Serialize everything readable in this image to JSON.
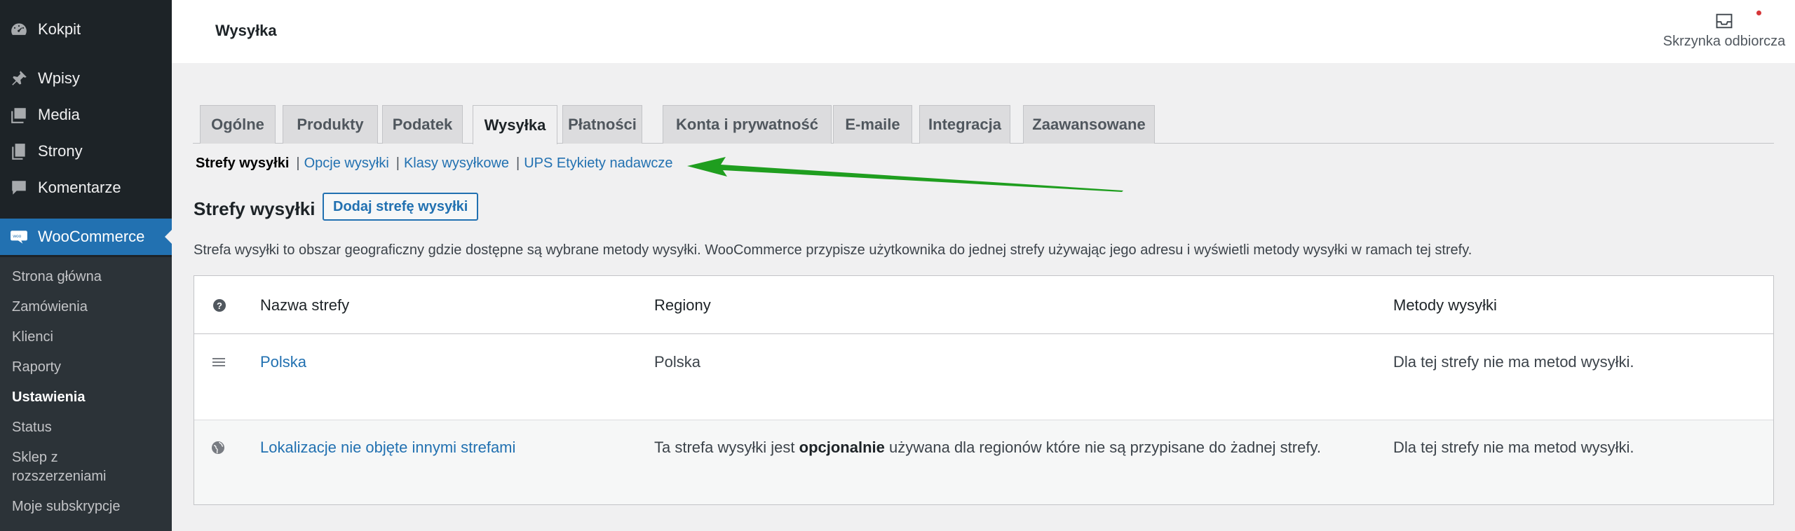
{
  "sidebar": {
    "items": [
      {
        "label": "Kokpit",
        "icon": "dashboard-icon"
      },
      {
        "label": "Wpisy",
        "icon": "pushpin-icon"
      },
      {
        "label": "Media",
        "icon": "media-icon"
      },
      {
        "label": "Strony",
        "icon": "pages-icon"
      },
      {
        "label": "Komentarze",
        "icon": "comment-icon"
      },
      {
        "label": "WooCommerce",
        "icon": "woo-icon"
      }
    ],
    "submenu": [
      {
        "label": "Strona główna"
      },
      {
        "label": "Zamówienia"
      },
      {
        "label": "Klienci"
      },
      {
        "label": "Raporty"
      },
      {
        "label": "Ustawienia"
      },
      {
        "label": "Status"
      },
      {
        "label": "Sklep z rozszerzeniami"
      },
      {
        "label": "Moje subskrypcje"
      }
    ]
  },
  "header": {
    "title": "Wysyłka",
    "inbox_label": "Skrzynka odbiorcza"
  },
  "tabs": [
    {
      "label": "Ogólne"
    },
    {
      "label": "Produkty"
    },
    {
      "label": "Podatek"
    },
    {
      "label": "Wysyłka",
      "active": true
    },
    {
      "label": "Płatności"
    },
    {
      "label": "Konta i prywatność"
    },
    {
      "label": "E-maile"
    },
    {
      "label": "Integracja"
    },
    {
      "label": "Zaawansowane"
    }
  ],
  "subnav": {
    "current": "Strefy wysyłki",
    "links": [
      "Opcje wysyłki",
      "Klasy wysyłkowe",
      "UPS Etykiety nadawcze"
    ],
    "separator": "|"
  },
  "annotation_arrow_color": "#1f9e1f",
  "zones": {
    "heading": "Strefy wysyłki",
    "add_button": "Dodaj strefę wysyłki",
    "description": "Strefa wysyłki to obszar geograficzny gdzie dostępne są wybrane metody wysyłki. WooCommerce przypisze użytkownika do jednej strefy używając jego adresu i wyświetli metody wysyłki w ramach tej strefy.",
    "columns": {
      "help_icon": "question-icon",
      "name": "Nazwa strefy",
      "regions": "Regiony",
      "methods": "Metody wysyłki"
    },
    "rows": [
      {
        "name": "Polska",
        "regions": "Polska",
        "methods": "Dla tej strefy nie ma metod wysyłki.",
        "icon": "drag-handle-icon"
      },
      {
        "name": "Lokalizacje nie objęte innymi strefami",
        "regions_before": "Ta strefa wysyłki jest",
        "regions_bold": "opcjonalnie",
        "regions_after": "używana dla regionów które nie są przypisane do żadnej strefy.",
        "methods": "Dla tej strefy nie ma metod wysyłki.",
        "icon": "globe-icon"
      }
    ]
  },
  "colors": {
    "sidebar_bg": "#1d2327",
    "accent": "#2271b1",
    "page_bg": "#f0f0f1"
  }
}
